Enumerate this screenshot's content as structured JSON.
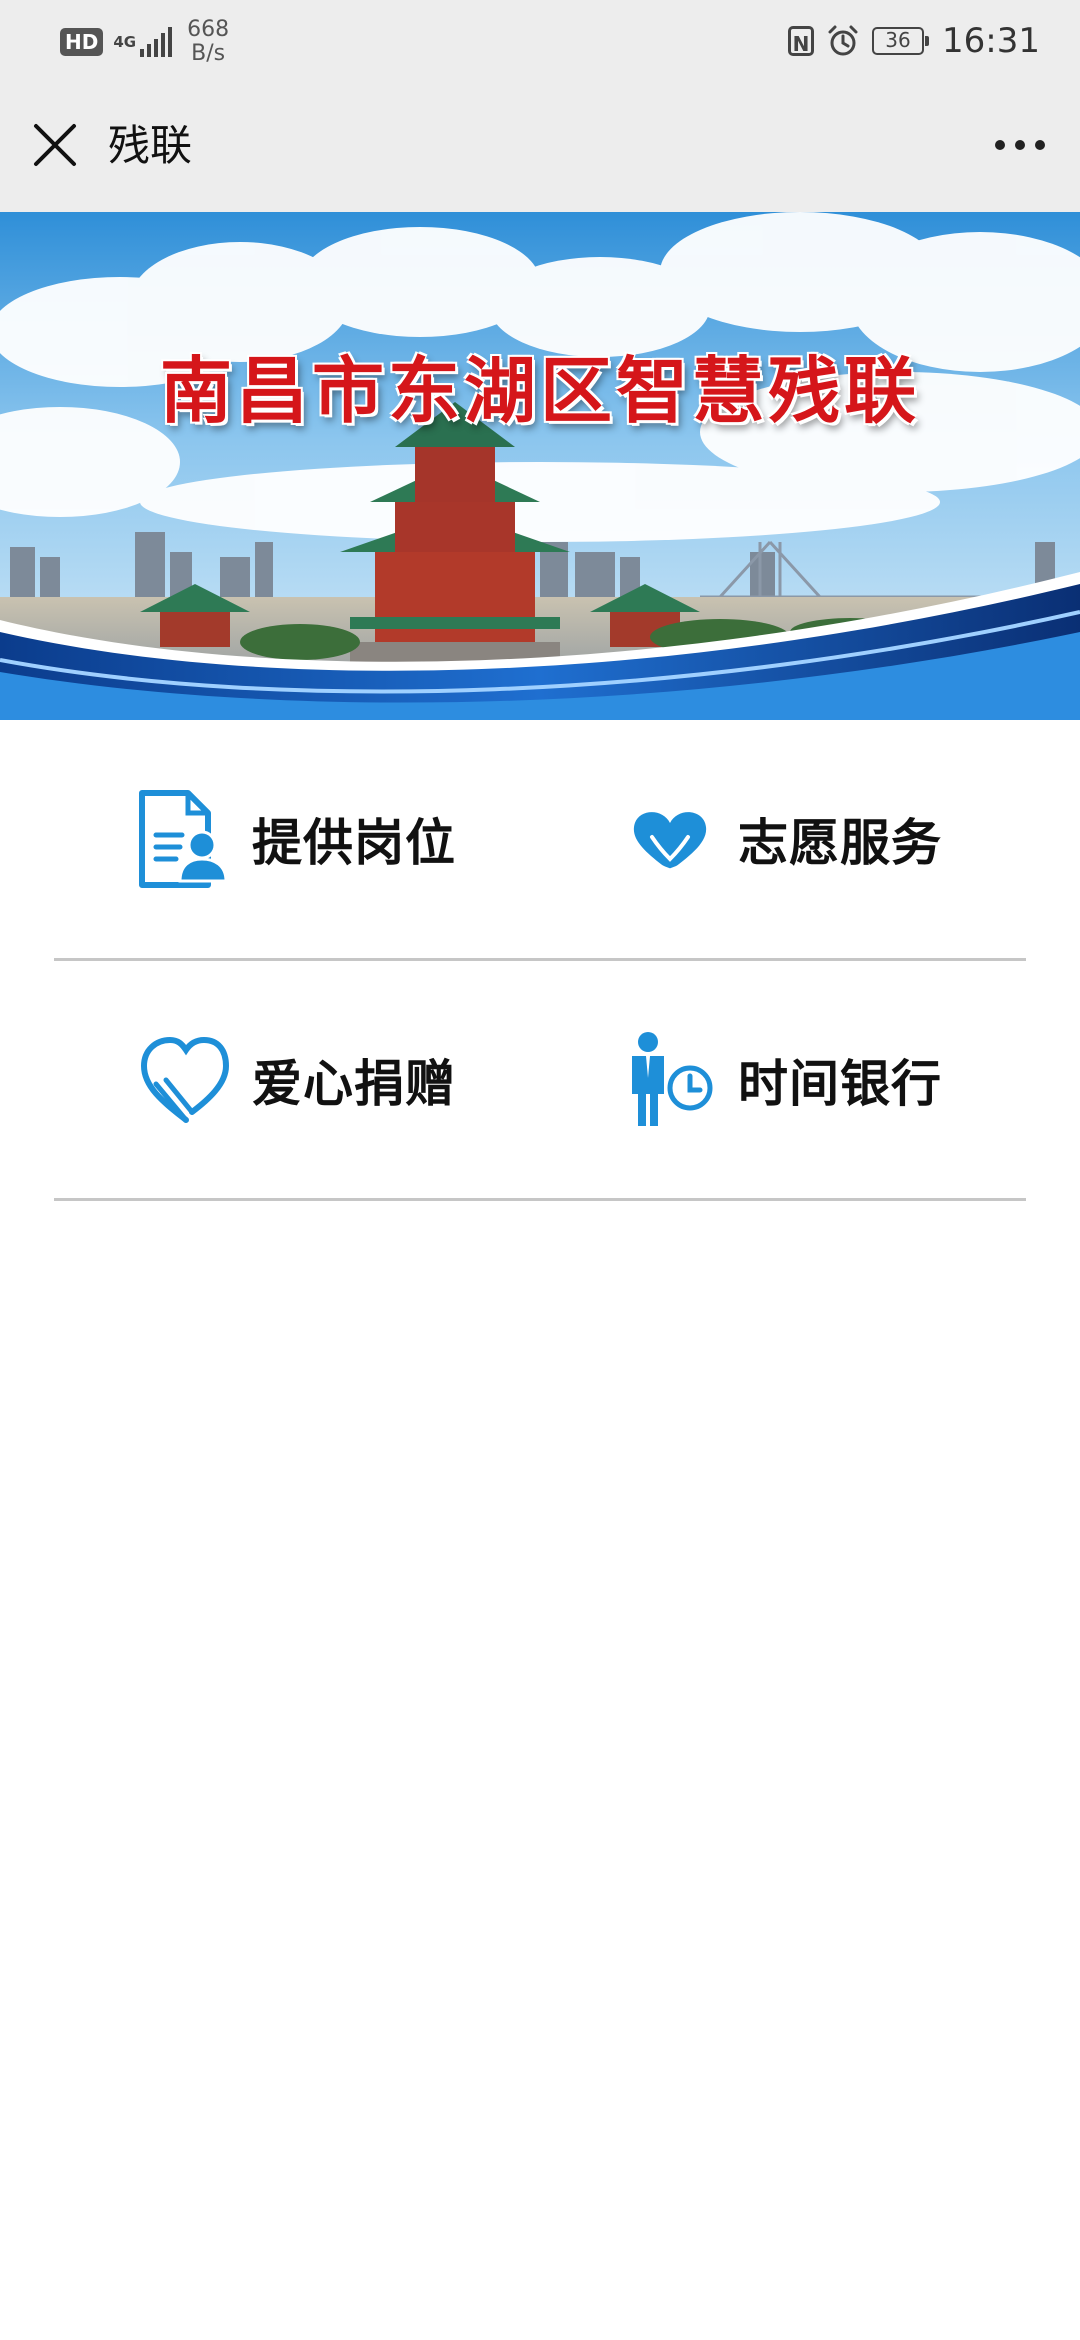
{
  "status_bar": {
    "hd": "HD",
    "network": "4G",
    "speed_value": "668",
    "speed_unit": "B/s",
    "nfc": "N",
    "battery": "36",
    "time": "16:31"
  },
  "header": {
    "title": "残联",
    "close_icon": "close-icon",
    "more_icon": "more-icon"
  },
  "banner": {
    "title": "南昌市东湖区智慧残联"
  },
  "menu": [
    {
      "label": "提供岗位",
      "icon": "job-document-person-icon"
    },
    {
      "label": "志愿服务",
      "icon": "heart-hands-icon"
    },
    {
      "label": "爱心捐赠",
      "icon": "heart-outline-icon"
    },
    {
      "label": "时间银行",
      "icon": "person-clock-icon"
    }
  ],
  "colors": {
    "accent": "#1e8fd8",
    "banner_title": "#d5161a",
    "header_bg": "#ededed",
    "divider": "#c6c6c6"
  }
}
